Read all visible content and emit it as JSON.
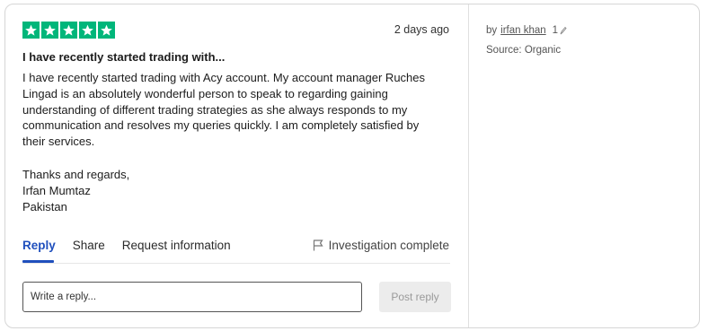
{
  "review": {
    "rating": 5,
    "date": "2 days ago",
    "title": "I have recently started trading with...",
    "body": "I have recently started trading with Acy account. My account manager Ruches Lingad is an absolutely wonderful person to speak to regarding gaining understanding of different trading strategies as she always responds to my communication and resolves my queries quickly. I am completely satisfied by their services.",
    "signoff": [
      "Thanks and regards,",
      "Irfan Mumtaz",
      "Pakistan"
    ]
  },
  "tabs": {
    "reply": "Reply",
    "share": "Share",
    "request": "Request information"
  },
  "investigation": "Investigation complete",
  "reply_box": {
    "placeholder": "Write a reply...",
    "post_label": "Post reply"
  },
  "meta": {
    "by": "by",
    "author": "irfan khan",
    "review_count": "1",
    "source": "Source: Organic"
  },
  "colors": {
    "star": "#00b67a",
    "accent": "#1f4fbd"
  }
}
